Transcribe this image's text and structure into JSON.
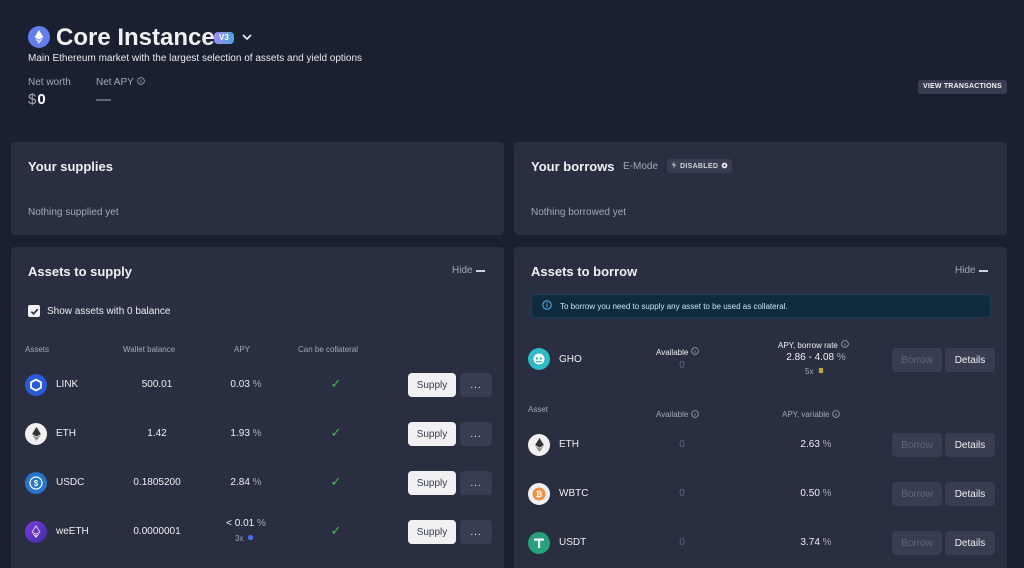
{
  "header": {
    "title": "Core Instance",
    "version_badge": "V3",
    "subtitle": "Main Ethereum market with the largest selection of assets and yield options",
    "net_worth_label": "Net worth",
    "net_worth_currency": "$",
    "net_worth_value": "0",
    "net_apy_label": "Net APY",
    "net_apy_value": "—",
    "view_transactions": "VIEW TRANSACTIONS"
  },
  "supplies": {
    "title": "Your supplies",
    "empty": "Nothing supplied yet"
  },
  "borrows": {
    "title": "Your borrows",
    "emode_label": "E-Mode",
    "emode_status": "DISABLED",
    "empty": "Nothing borrowed yet"
  },
  "assets_to_supply": {
    "title": "Assets to supply",
    "hide_label": "Hide",
    "show_zero_label": "Show assets with 0 balance",
    "columns": [
      "Assets",
      "Wallet balance",
      "APY",
      "Can be collateral"
    ],
    "supply_label": "Supply",
    "more_label": "...",
    "rows": [
      {
        "symbol": "LINK",
        "balance": "500.01",
        "apy": "0.03",
        "pct": "%",
        "icon": "link-icon",
        "color": "#2a5ada"
      },
      {
        "symbol": "ETH",
        "balance": "1.42",
        "apy": "1.93",
        "pct": "%",
        "icon": "eth-icon",
        "color": "#f1f1f3"
      },
      {
        "symbol": "USDC",
        "balance": "0.1805200",
        "apy": "2.84",
        "pct": "%",
        "icon": "usdc-icon",
        "color": "#2775ca"
      },
      {
        "symbol": "weETH",
        "balance": "0.0000001",
        "apy": "< 0.01",
        "pct": "%",
        "extra": "3x",
        "icon": "weeth-icon",
        "color": "#7b3fe4"
      }
    ]
  },
  "assets_to_borrow": {
    "title": "Assets to borrow",
    "hide_label": "Hide",
    "info": "To borrow you need to supply any asset to be used as collateral.",
    "gho": {
      "symbol": "GHO",
      "available_label": "Available",
      "available": "0",
      "rate_label": "APY, borrow rate",
      "rate": "2.86 - 4.08",
      "pct": "%",
      "extra": "5x"
    },
    "columns": [
      "Asset",
      "Available",
      "APY, variable"
    ],
    "borrow_label": "Borrow",
    "details_label": "Details",
    "rows": [
      {
        "symbol": "ETH",
        "available": "0",
        "apy": "2.63",
        "pct": "%",
        "icon": "eth-icon",
        "color": "#f1f1f3"
      },
      {
        "symbol": "WBTC",
        "available": "0",
        "apy": "0.50",
        "pct": "%",
        "icon": "wbtc-icon",
        "color": "#f09242"
      },
      {
        "symbol": "USDT",
        "available": "0",
        "apy": "3.74",
        "pct": "%",
        "icon": "usdt-icon",
        "color": "#26a17b"
      }
    ]
  },
  "colors": {
    "background": "#1b2030",
    "panel": "#292e41",
    "accent_check": "#46bc4b",
    "gho_green": "#2ebac6"
  }
}
